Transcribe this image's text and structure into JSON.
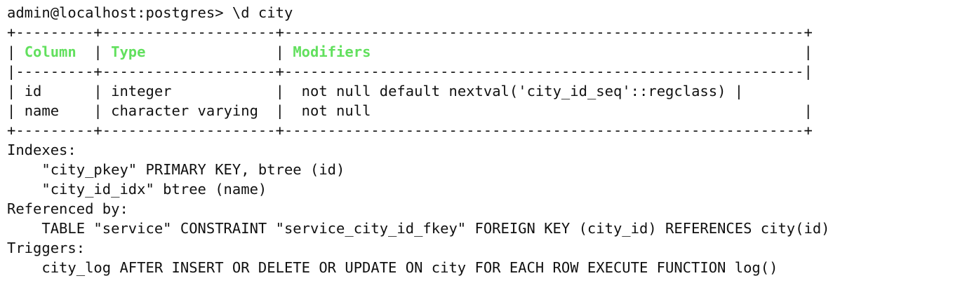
{
  "prompt": {
    "text": "admin@localhost:postgres> ",
    "command": "\\d city"
  },
  "table": {
    "top_border": "+---------+--------------------+------------------------------------------------------------+",
    "header_sep": "|---------+--------------------+------------------------------------------------------------|",
    "bottom_border": "+---------+--------------------+------------------------------------------------------------+",
    "headers": [
      "Column",
      "Type",
      "Modifiers"
    ],
    "rows": [
      {
        "column": "id",
        "type": "integer",
        "modifiers": "not null default nextval('city_id_seq'::regclass)"
      },
      {
        "column": "name",
        "type": "character varying",
        "modifiers": "not null"
      }
    ]
  },
  "sections": {
    "indexes_label": "Indexes:",
    "indexes": [
      "\"city_pkey\" PRIMARY KEY, btree (id)",
      "\"city_id_idx\" btree (name)"
    ],
    "referenced_label": "Referenced by:",
    "referenced": [
      "TABLE \"service\" CONSTRAINT \"service_city_id_fkey\" FOREIGN KEY (city_id) REFERENCES city(id)"
    ],
    "triggers_label": "Triggers:",
    "triggers": [
      "city_log AFTER INSERT OR DELETE OR UPDATE ON city FOR EACH ROW EXECUTE FUNCTION log()"
    ]
  },
  "colors": {
    "header_text": "#62e05e",
    "text": "#111111",
    "background": "#ffffff"
  }
}
